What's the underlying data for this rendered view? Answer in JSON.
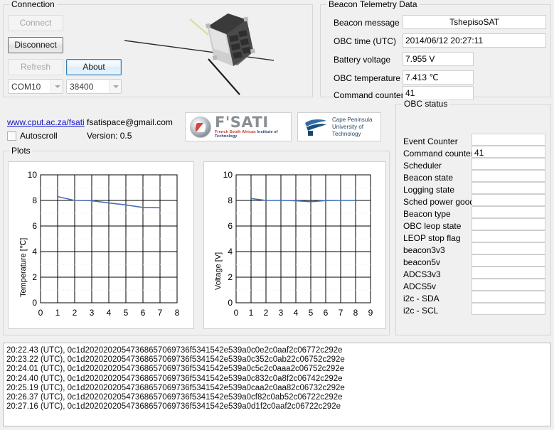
{
  "connection": {
    "title": "Connection",
    "buttons": {
      "connect": "Connect",
      "disconnect": "Disconnect",
      "refresh": "Refresh",
      "about": "About"
    },
    "port_value": "COM10",
    "baud_value": "38400"
  },
  "telemetry": {
    "title": "Beacon Telemetry Data",
    "rows": [
      {
        "label": "Beacon message",
        "value": "TshepisoSAT"
      },
      {
        "label": "OBC time (UTC)",
        "value": "2014/06/12 20:27:11"
      },
      {
        "label": "Battery voltage",
        "value": "7.955 V"
      },
      {
        "label": "OBC temperature",
        "value": "7.413 ℃"
      },
      {
        "label": "Command counter",
        "value": "41"
      }
    ]
  },
  "obc_status": {
    "title": "OBC status",
    "rows": [
      {
        "label": "Event Counter",
        "value": ""
      },
      {
        "label": "Command counter",
        "value": "41"
      },
      {
        "label": "Scheduler",
        "value": ""
      },
      {
        "label": "Beacon state",
        "value": ""
      },
      {
        "label": "Logging state",
        "value": ""
      },
      {
        "label": "Sched power good",
        "value": ""
      },
      {
        "label": "Beacon type",
        "value": ""
      },
      {
        "label": "OBC leop state",
        "value": ""
      },
      {
        "label": "LEOP stop flag",
        "value": ""
      },
      {
        "label": "beacon3v3",
        "value": ""
      },
      {
        "label": "beacon5v",
        "value": ""
      },
      {
        "label": "ADCS3v3",
        "value": ""
      },
      {
        "label": "ADCS5v",
        "value": ""
      },
      {
        "label": "i2c - SDA",
        "value": ""
      },
      {
        "label": "i2c - SCL",
        "value": ""
      }
    ]
  },
  "footer": {
    "website": "www.cput.ac.za/fsati",
    "email": "fsatispace@gmail.com",
    "version": "Version: 0.5",
    "autoscroll_label": "Autoscroll",
    "autoscroll_checked": false
  },
  "logos": {
    "fsati_name": "F'SATI",
    "fsati_tagline_a": "French South African",
    "fsati_tagline_b": "Institute of Technology",
    "cput_line1": "Cape Peninsula",
    "cput_line2": "University of Technology"
  },
  "plots": {
    "title": "Plots"
  },
  "chart_data": [
    {
      "type": "line",
      "title": "",
      "xlabel": "",
      "ylabel": "Temperature [℃]",
      "xlim": [
        0,
        8
      ],
      "ylim": [
        0,
        10
      ],
      "xticks": [
        0,
        1,
        2,
        3,
        4,
        5,
        6,
        7,
        8
      ],
      "yticks": [
        0,
        2,
        4,
        6,
        8,
        10
      ],
      "grid": true,
      "legend": "none",
      "color": "#4a6fb5",
      "x": [
        1,
        2,
        3,
        4,
        5,
        6,
        7
      ],
      "values": [
        8.3,
        8.0,
        7.98,
        7.8,
        7.65,
        7.45,
        7.43
      ]
    },
    {
      "type": "line",
      "title": "",
      "xlabel": "",
      "ylabel": "Voltage [V]",
      "xlim": [
        0,
        9
      ],
      "ylim": [
        0,
        10
      ],
      "xticks": [
        0,
        1,
        2,
        3,
        4,
        5,
        6,
        7,
        8,
        9
      ],
      "yticks": [
        0,
        2,
        4,
        6,
        8,
        10
      ],
      "grid": true,
      "legend": "none",
      "color": "#3f6fbf",
      "x": [
        1,
        2,
        3,
        4,
        5,
        6,
        7,
        8
      ],
      "values": [
        8.15,
        8.0,
        8.0,
        7.97,
        7.9,
        7.99,
        8.0,
        8.0
      ]
    }
  ],
  "log": {
    "lines": [
      "20:22.43 (UTC), 0c1d20202020547368657069736f5341542e539a0c0e2c0aaf2c06772c292e",
      "20:23.22 (UTC), 0c1d20202020547368657069736f5341542e539a0c352c0ab22c06752c292e",
      "20:24.01 (UTC), 0c1d20202020547368657069736f5341542e539a0c5c2c0aaa2c06752c292e",
      "20:24.40 (UTC), 0c1d20202020547368657069736f5341542e539a0c832c0a8f2c06742c292e",
      "20:25.19 (UTC), 0c1d20202020547368657069736f5341542e539a0caa2c0aa82c06732c292e",
      "20:26.37 (UTC), 0c1d20202020547368657069736f5341542e539a0cf82c0ab52c06722c292e",
      "20:27.16 (UTC), 0c1d20202020547368657069736f5341542e539a0d1f2c0aaf2c06722c292e"
    ]
  }
}
